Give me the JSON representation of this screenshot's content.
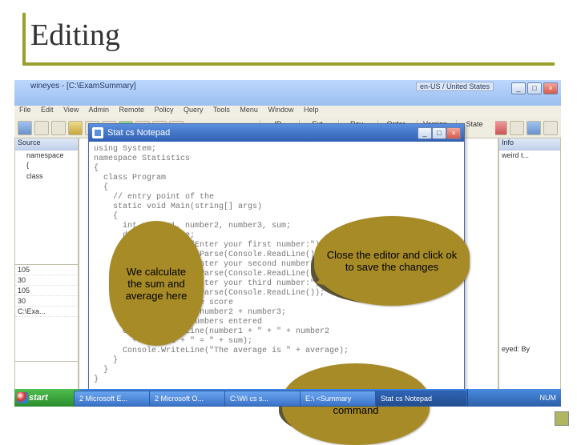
{
  "slide": {
    "title": "Editing"
  },
  "outerWindow": {
    "caption": "wineyes - [C:\\ExamSummary]",
    "langBadge": "en-US / United States"
  },
  "menu": {
    "items": [
      "File",
      "Edit",
      "View",
      "Admin",
      "Remote",
      "Policy",
      "Query",
      "Tools",
      "Menu",
      "Window",
      "Help"
    ]
  },
  "toolbar": {
    "tabLabel": "C:\\ExamSummary",
    "fieldLabels": [
      "ID",
      "Ext",
      "Rev",
      "Order",
      "Version",
      "State"
    ]
  },
  "leftPanel": {
    "header": "Source",
    "items": [
      "namespace",
      "{",
      "",
      "class"
    ]
  },
  "leftLower": {
    "rows": [
      "105",
      "30",
      "105",
      "30",
      "C:\\Exa..."
    ]
  },
  "rightPanel": {
    "header": "Info",
    "lines": [
      "weird t...",
      "",
      "",
      "",
      "",
      "",
      "",
      "",
      "",
      "",
      "eyed: By"
    ]
  },
  "notepad": {
    "title": "Stat cs   Notepad",
    "code": [
      "using System;",
      "namespace Statistics",
      "{",
      "  class Program",
      "  {",
      "    // entry point of the",
      "    static void Main(string[] args)",
      "    {",
      "      int number1, number2, number3, sum;",
      "      double average;",
      "      Console.Write(\"Enter your first number:\");",
      "      number1 = Int32.Parse(Console.ReadLine());",
      "      Console.Write(\"Enter your second number:\");",
      "      number2 = Int32.Parse(Console.ReadLine());",
      "      Console.Write(\"Enter your third number:\");",
      "      number3 = Int32.Parse(Console.ReadLine());",
      "",
      "      //calculating the score",
      "      sum = number1 + number2 + number3;",
      "      //Display the numbers entered",
      "      Console.WriteLine(number1 + \" + \" + number2",
      "        + number3 + \" = \" + sum);",
      "",
      "      Console.WriteLine(\"The average is \" + average);",
      "    }",
      "  }",
      "}"
    ]
  },
  "callouts": {
    "c1": "We calculate the sum and average here",
    "c2": "Close the editor and click ok to save the changes",
    "c3": "We display the result in the command"
  },
  "taskbar": {
    "start": "start",
    "tasks": [
      {
        "label": "2 Microsoft E..."
      },
      {
        "label": "2 Microsoft O..."
      },
      {
        "label": "C:\\Wi cs  s..."
      },
      {
        "label": "E:\\ <Summary"
      },
      {
        "label": "Stat cs  Notepad"
      }
    ],
    "trayTime": "NUM"
  }
}
